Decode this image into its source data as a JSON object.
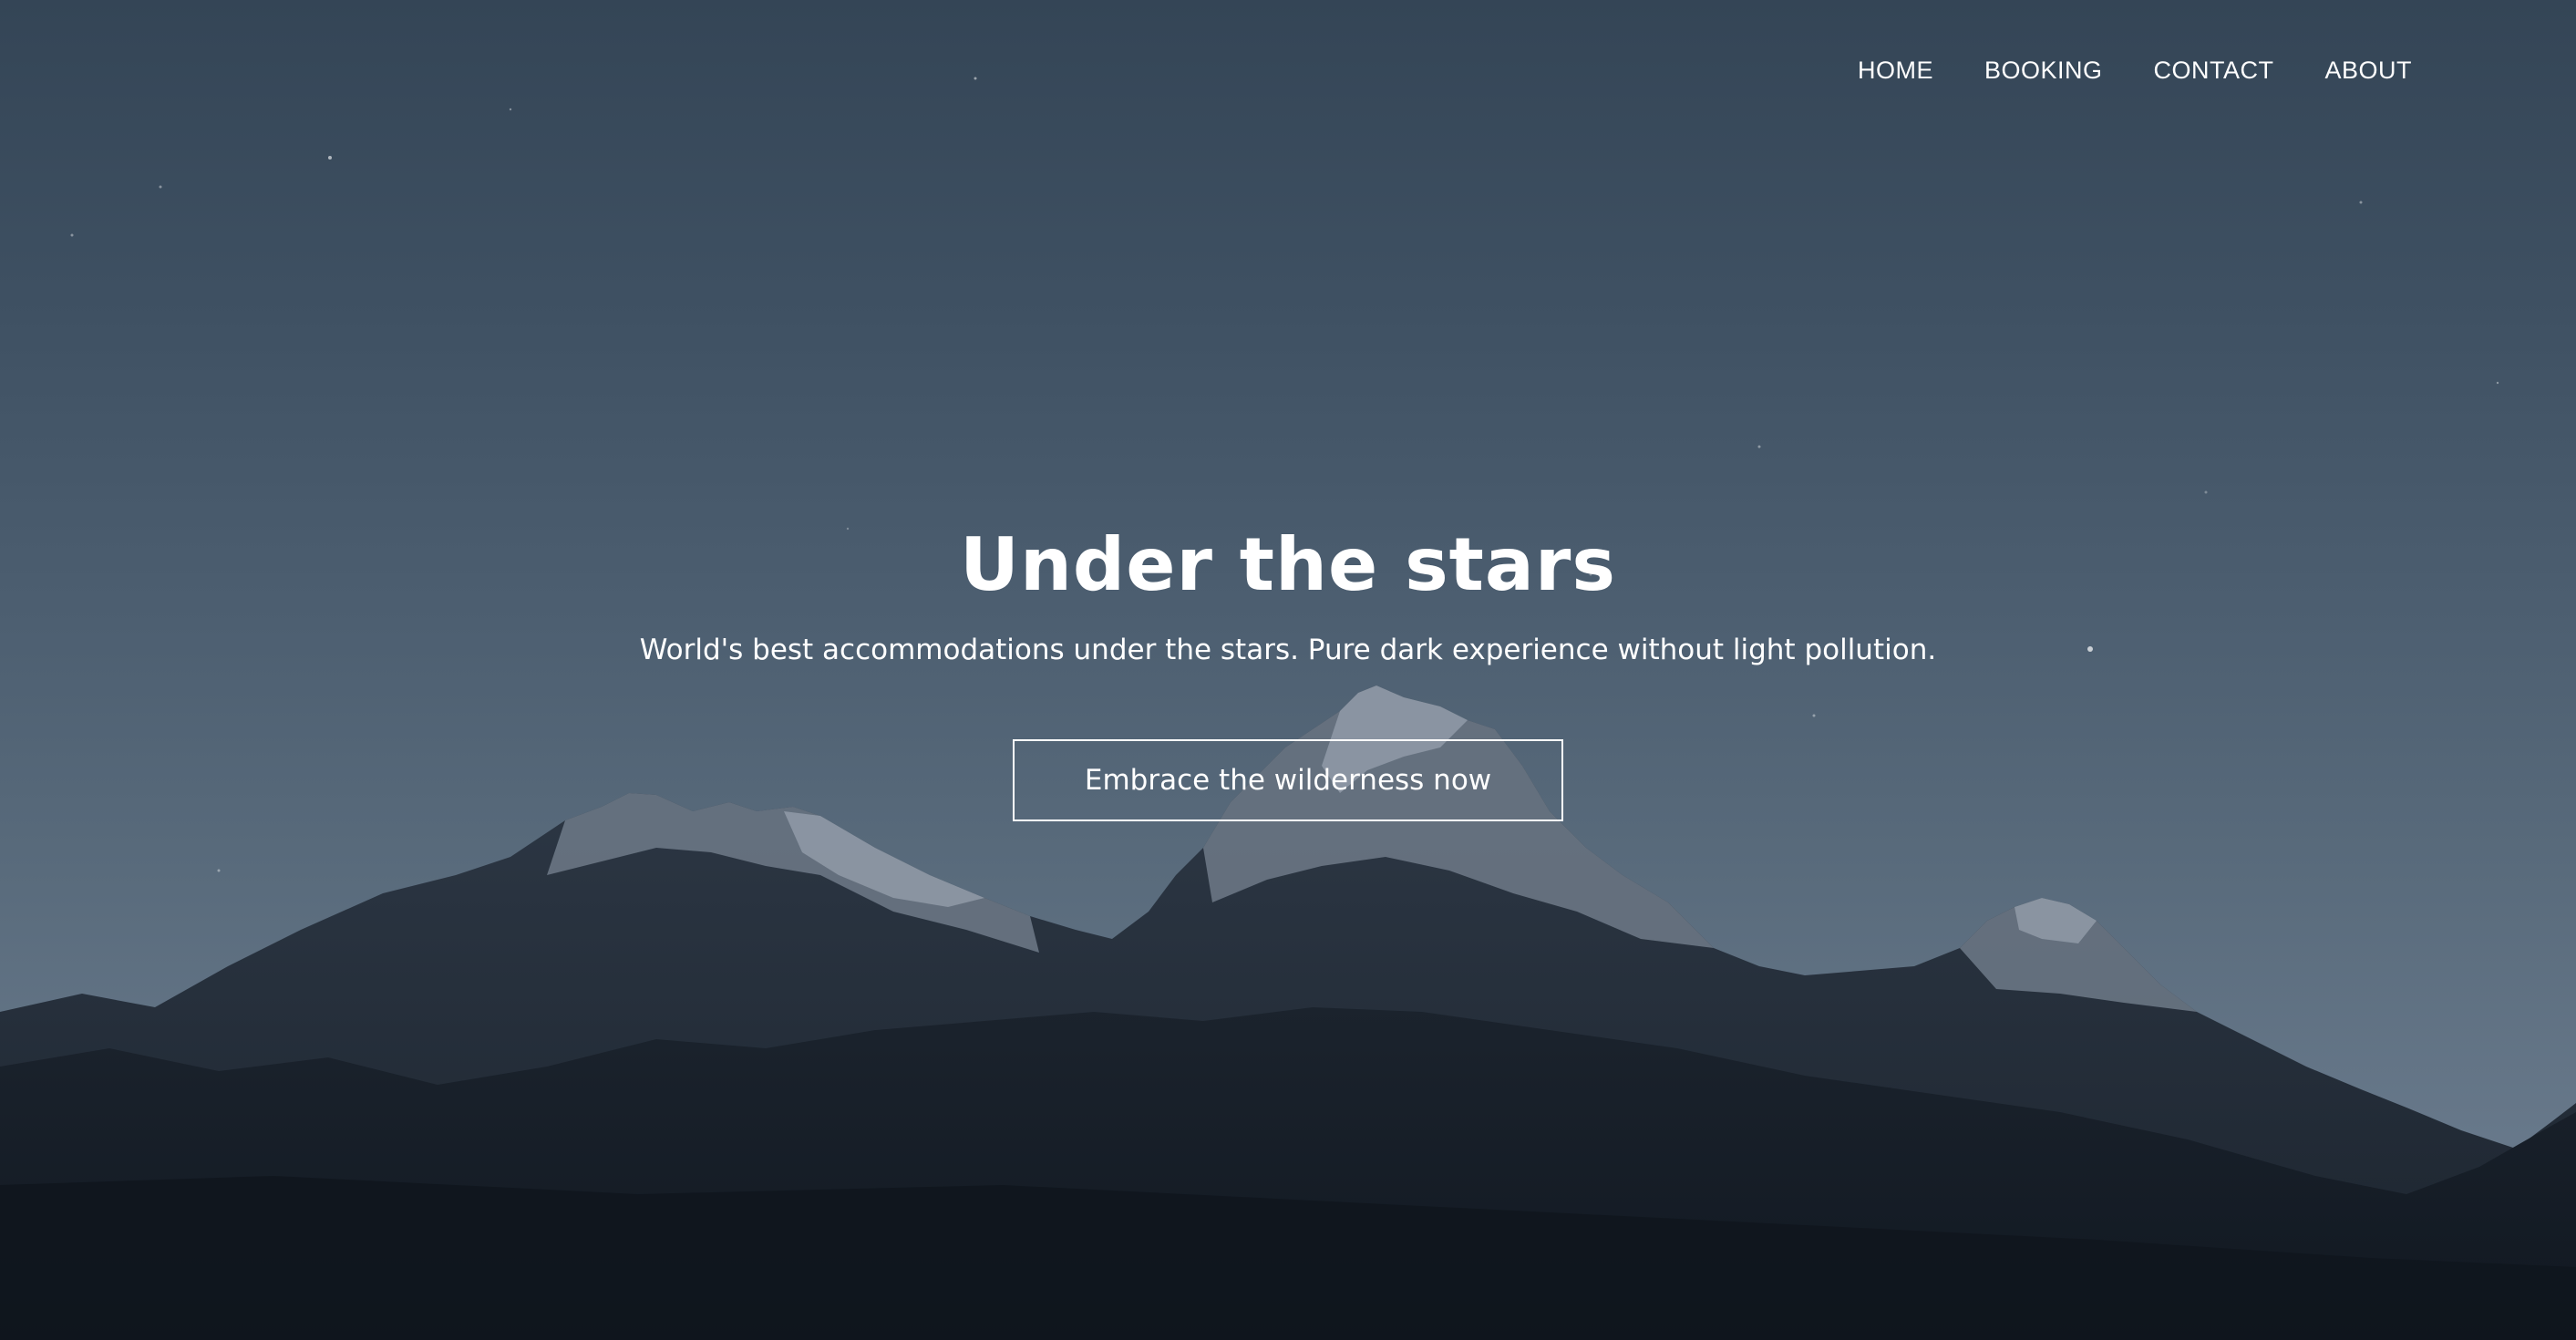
{
  "nav": {
    "items": [
      {
        "label": "HOME"
      },
      {
        "label": "BOOKING"
      },
      {
        "label": "CONTACT"
      },
      {
        "label": "ABOUT"
      }
    ]
  },
  "hero": {
    "title": "Under the stars",
    "subtitle": "World's best accommodations under the stars. Pure dark experience without light pollution.",
    "cta_label": "Embrace the wilderness now",
    "background_image": "night-mountain-landscape"
  },
  "colors": {
    "sky_top": "#344556",
    "sky_bottom": "#6c7d8e",
    "text": "#ffffff",
    "mountain_dark": "#161e28"
  }
}
